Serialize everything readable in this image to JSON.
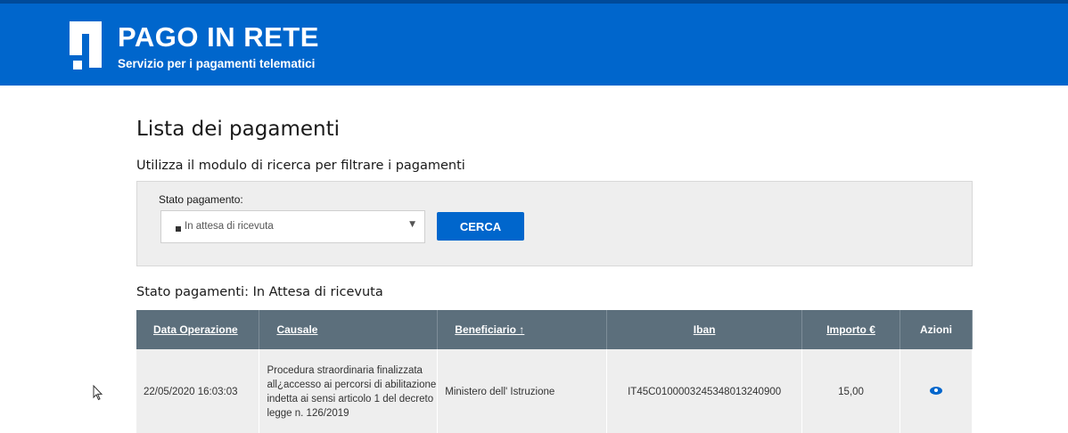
{
  "header": {
    "title": "PAGO IN RETE",
    "subtitle": "Servizio per i pagamenti telematici"
  },
  "page": {
    "title": "Lista dei pagamenti",
    "subtitle": "Utilizza il modulo di ricerca per filtrare i pagamenti"
  },
  "filter": {
    "label": "Stato pagamento:",
    "selected": "In attesa di ricevuta",
    "button": "CERCA"
  },
  "results": {
    "title": "Stato pagamenti: In Attesa di ricevuta",
    "columns": [
      "Data Operazione",
      "Causale",
      "Beneficiario ↑",
      "Iban",
      "Importo €",
      "Azioni"
    ],
    "rows": [
      {
        "data": "22/05/2020 16:03:03",
        "causale": "Procedura straordinaria finalizzata all¿accesso ai percorsi di abilitazione indetta ai sensi articolo 1 del decreto legge n. 126/2019",
        "beneficiario": "Ministero dell' Istruzione",
        "iban": "IT45C0100003245348013240900",
        "importo": "15,00",
        "azione_icon": "eye-icon"
      }
    ]
  },
  "colors": {
    "header_blue": "#0066cc",
    "table_header": "#5c6f7c",
    "row_bg": "#eeeeee"
  }
}
